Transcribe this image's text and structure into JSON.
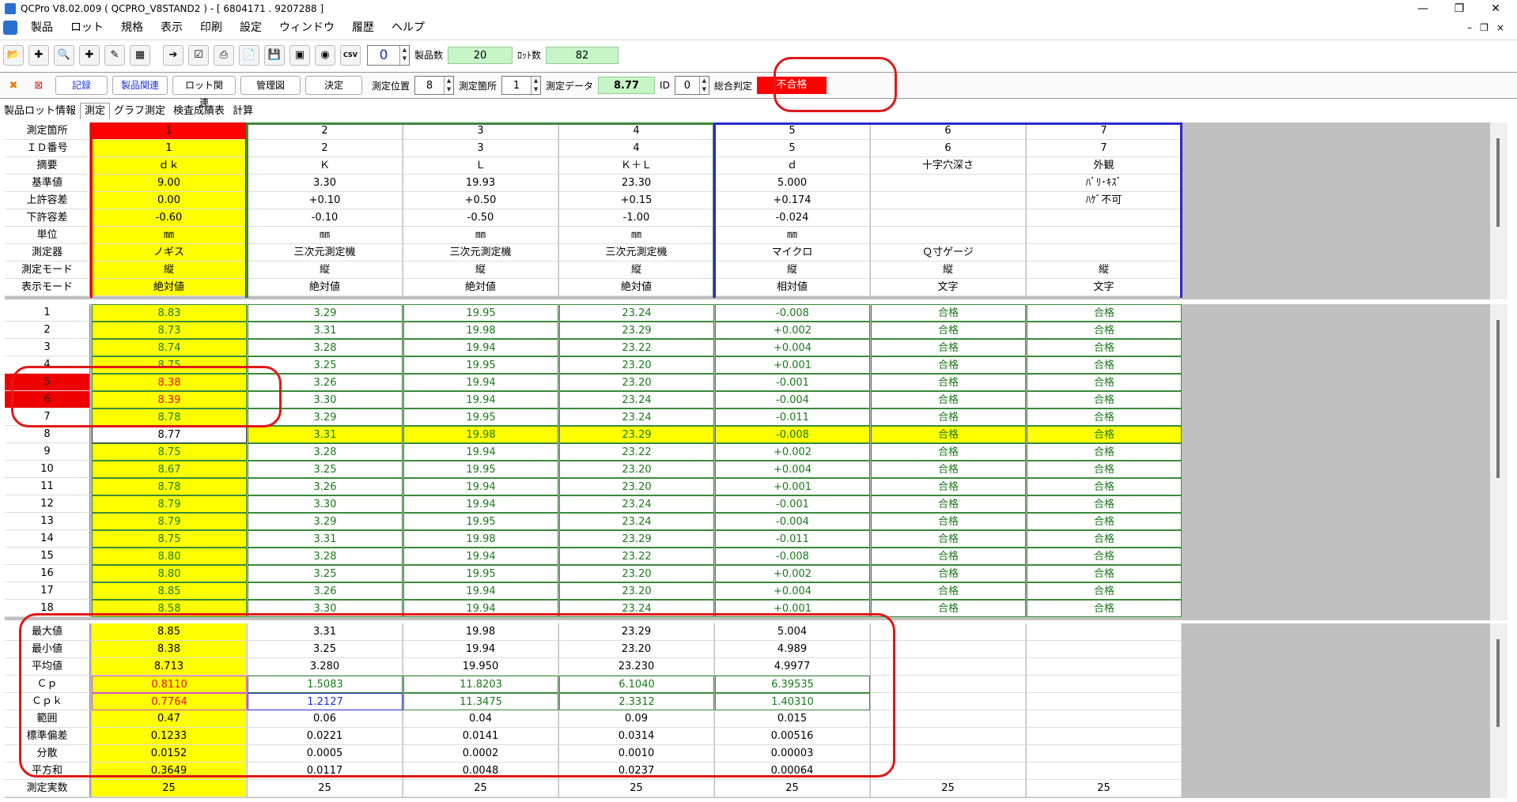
{
  "window": {
    "title": "QCPro V8.02.009 ( QCPRO_V8STAND2 )  - [ 6804171 . 9207288 ]",
    "controls": [
      "—",
      "❐",
      "✕"
    ],
    "mdi_controls": [
      "–",
      "❐",
      "×"
    ]
  },
  "menu": [
    "製品",
    "ロット",
    "規格",
    "表示",
    "印刷",
    "設定",
    "ウィンドウ",
    "履歴",
    "ヘルプ"
  ],
  "toolbar": {
    "icons": [
      "open-product-icon",
      "add-product-icon",
      "search-product-icon",
      "add-lot-icon",
      "edit-icon",
      "table-icon",
      "export-icon",
      "checklist-icon",
      "print-icon",
      "report-icon",
      "save-icon",
      "image-icon",
      "camera-icon",
      "csv-icon"
    ],
    "counter": "0",
    "product_count_label": "製品数",
    "product_count": "20",
    "lot_count_label": "ﾛｯﾄ数",
    "lot_count": "82"
  },
  "controls": {
    "buttons": [
      "記録",
      "製品関連",
      "ロット関連",
      "管理図",
      "決定"
    ],
    "pos_label": "測定位置",
    "pos_value": "8",
    "loc_label": "測定箇所",
    "loc_value": "1",
    "data_label": "測定データ",
    "data_value": "8.77",
    "id_label": "ID",
    "id_value": "0",
    "judge_label": "総合判定",
    "judge_value": "不合格"
  },
  "tabs": [
    "製品ロット情報",
    "測定",
    "グラフ測定",
    "検査成績表",
    "計算"
  ],
  "header": {
    "row_labels": [
      "測定箇所",
      "ＩＤ番号",
      "摘要",
      "基準値",
      "上許容差",
      "下許容差",
      "単位",
      "測定器",
      "測定モード",
      "表示モード"
    ],
    "columns": [
      [
        "1",
        "1",
        "ｄｋ",
        "9.00",
        "0.00",
        "-0.60",
        "㎜",
        "ノギス",
        "縦",
        "絶対値"
      ],
      [
        "2",
        "2",
        "Ｋ",
        "3.30",
        "+0.10",
        "-0.10",
        "㎜",
        "三次元測定機",
        "縦",
        "絶対値"
      ],
      [
        "3",
        "3",
        "Ｌ",
        "19.93",
        "+0.50",
        "-0.50",
        "㎜",
        "三次元測定機",
        "縦",
        "絶対値"
      ],
      [
        "4",
        "4",
        "Ｋ＋Ｌ",
        "23.30",
        "+0.15",
        "-1.00",
        "㎜",
        "三次元測定機",
        "縦",
        "絶対値"
      ],
      [
        "5",
        "5",
        "ｄ",
        "5.000",
        "+0.174",
        "-0.024",
        "㎜",
        "マイクロ",
        "縦",
        "相対値"
      ],
      [
        "6",
        "6",
        "十字穴深さ",
        "",
        "",
        "",
        "",
        "Ｑ寸ゲージ",
        "縦",
        "文字"
      ],
      [
        "7",
        "7",
        "外観",
        "ﾊﾞﾘ･ｷｽﾞ",
        "ﾊｹﾞ不可",
        "",
        "",
        "",
        "縦",
        "文字"
      ]
    ]
  },
  "data_rows": [
    [
      "1",
      "8.83",
      "3.29",
      "19.95",
      "23.24",
      "-0.008",
      "合格",
      "合格"
    ],
    [
      "2",
      "8.73",
      "3.31",
      "19.98",
      "23.29",
      "+0.002",
      "合格",
      "合格"
    ],
    [
      "3",
      "8.74",
      "3.28",
      "19.94",
      "23.22",
      "+0.004",
      "合格",
      "合格"
    ],
    [
      "4",
      "8.75",
      "3.25",
      "19.95",
      "23.20",
      "+0.001",
      "合格",
      "合格"
    ],
    [
      "5",
      "8.38",
      "3.26",
      "19.94",
      "23.20",
      "-0.001",
      "合格",
      "合格"
    ],
    [
      "6",
      "8.39",
      "3.30",
      "19.94",
      "23.24",
      "-0.004",
      "合格",
      "合格"
    ],
    [
      "7",
      "8.78",
      "3.29",
      "19.95",
      "23.24",
      "-0.011",
      "合格",
      "合格"
    ],
    [
      "8",
      "8.77",
      "3.31",
      "19.98",
      "23.29",
      "-0.008",
      "合格",
      "合格"
    ],
    [
      "9",
      "8.75",
      "3.28",
      "19.94",
      "23.22",
      "+0.002",
      "合格",
      "合格"
    ],
    [
      "10",
      "8.67",
      "3.25",
      "19.95",
      "23.20",
      "+0.004",
      "合格",
      "合格"
    ],
    [
      "11",
      "8.78",
      "3.26",
      "19.94",
      "23.20",
      "+0.001",
      "合格",
      "合格"
    ],
    [
      "12",
      "8.79",
      "3.30",
      "19.94",
      "23.24",
      "-0.001",
      "合格",
      "合格"
    ],
    [
      "13",
      "8.79",
      "3.29",
      "19.95",
      "23.24",
      "-0.004",
      "合格",
      "合格"
    ],
    [
      "14",
      "8.75",
      "3.31",
      "19.98",
      "23.29",
      "-0.011",
      "合格",
      "合格"
    ],
    [
      "15",
      "8.80",
      "3.28",
      "19.94",
      "23.22",
      "-0.008",
      "合格",
      "合格"
    ],
    [
      "16",
      "8.80",
      "3.25",
      "19.95",
      "23.20",
      "+0.002",
      "合格",
      "合格"
    ],
    [
      "17",
      "8.85",
      "3.26",
      "19.94",
      "23.20",
      "+0.004",
      "合格",
      "合格"
    ],
    [
      "18",
      "8.58",
      "3.30",
      "19.94",
      "23.24",
      "+0.001",
      "合格",
      "合格"
    ]
  ],
  "ng_rows": [
    "5",
    "6"
  ],
  "current_row": "8",
  "stat_rows": [
    [
      "最大値",
      "8.85",
      "3.31",
      "19.98",
      "23.29",
      "5.004",
      "",
      ""
    ],
    [
      "最小値",
      "8.38",
      "3.25",
      "19.94",
      "23.20",
      "4.989",
      "",
      ""
    ],
    [
      "平均値",
      "8.713",
      "3.280",
      "19.950",
      "23.230",
      "4.9977",
      "",
      ""
    ],
    [
      "Ｃｐ",
      "0.8110",
      "1.5083",
      "11.8203",
      "6.1040",
      "6.39535",
      "",
      ""
    ],
    [
      "Ｃｐｋ",
      "0.7764",
      "1.2127",
      "11.3475",
      "2.3312",
      "1.40310",
      "",
      ""
    ],
    [
      "範囲",
      "0.47",
      "0.06",
      "0.04",
      "0.09",
      "0.015",
      "",
      ""
    ],
    [
      "標準偏差",
      "0.1233",
      "0.0221",
      "0.0141",
      "0.0314",
      "0.00516",
      "",
      ""
    ],
    [
      "分散",
      "0.0152",
      "0.0005",
      "0.0002",
      "0.0010",
      "0.00003",
      "",
      ""
    ],
    [
      "平方和",
      "0.3649",
      "0.0117",
      "0.0048",
      "0.0237",
      "0.00064",
      "",
      ""
    ],
    [
      "測定実数",
      "25",
      "25",
      "25",
      "25",
      "25",
      "25",
      "25"
    ]
  ]
}
